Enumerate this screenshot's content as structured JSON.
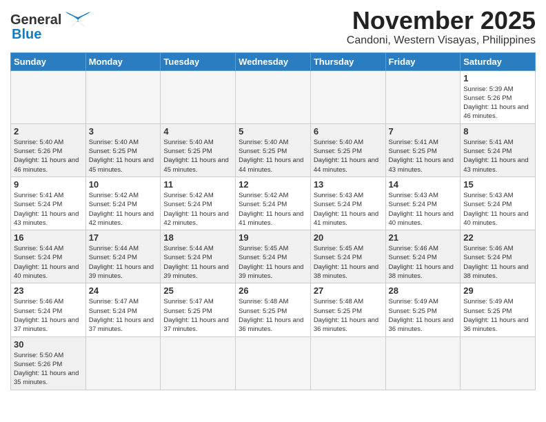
{
  "header": {
    "logo_text_general": "General",
    "logo_text_blue": "Blue",
    "month_title": "November 2025",
    "subtitle": "Candoni, Western Visayas, Philippines"
  },
  "days_of_week": [
    "Sunday",
    "Monday",
    "Tuesday",
    "Wednesday",
    "Thursday",
    "Friday",
    "Saturday"
  ],
  "weeks": [
    {
      "days": [
        {
          "date": "",
          "info": ""
        },
        {
          "date": "",
          "info": ""
        },
        {
          "date": "",
          "info": ""
        },
        {
          "date": "",
          "info": ""
        },
        {
          "date": "",
          "info": ""
        },
        {
          "date": "",
          "info": ""
        },
        {
          "date": "1",
          "info": "Sunrise: 5:39 AM\nSunset: 5:26 PM\nDaylight: 11 hours and 46 minutes."
        }
      ]
    },
    {
      "days": [
        {
          "date": "2",
          "info": "Sunrise: 5:40 AM\nSunset: 5:26 PM\nDaylight: 11 hours and 46 minutes."
        },
        {
          "date": "3",
          "info": "Sunrise: 5:40 AM\nSunset: 5:25 PM\nDaylight: 11 hours and 45 minutes."
        },
        {
          "date": "4",
          "info": "Sunrise: 5:40 AM\nSunset: 5:25 PM\nDaylight: 11 hours and 45 minutes."
        },
        {
          "date": "5",
          "info": "Sunrise: 5:40 AM\nSunset: 5:25 PM\nDaylight: 11 hours and 44 minutes."
        },
        {
          "date": "6",
          "info": "Sunrise: 5:40 AM\nSunset: 5:25 PM\nDaylight: 11 hours and 44 minutes."
        },
        {
          "date": "7",
          "info": "Sunrise: 5:41 AM\nSunset: 5:25 PM\nDaylight: 11 hours and 43 minutes."
        },
        {
          "date": "8",
          "info": "Sunrise: 5:41 AM\nSunset: 5:24 PM\nDaylight: 11 hours and 43 minutes."
        }
      ]
    },
    {
      "days": [
        {
          "date": "9",
          "info": "Sunrise: 5:41 AM\nSunset: 5:24 PM\nDaylight: 11 hours and 43 minutes."
        },
        {
          "date": "10",
          "info": "Sunrise: 5:42 AM\nSunset: 5:24 PM\nDaylight: 11 hours and 42 minutes."
        },
        {
          "date": "11",
          "info": "Sunrise: 5:42 AM\nSunset: 5:24 PM\nDaylight: 11 hours and 42 minutes."
        },
        {
          "date": "12",
          "info": "Sunrise: 5:42 AM\nSunset: 5:24 PM\nDaylight: 11 hours and 41 minutes."
        },
        {
          "date": "13",
          "info": "Sunrise: 5:43 AM\nSunset: 5:24 PM\nDaylight: 11 hours and 41 minutes."
        },
        {
          "date": "14",
          "info": "Sunrise: 5:43 AM\nSunset: 5:24 PM\nDaylight: 11 hours and 40 minutes."
        },
        {
          "date": "15",
          "info": "Sunrise: 5:43 AM\nSunset: 5:24 PM\nDaylight: 11 hours and 40 minutes."
        }
      ]
    },
    {
      "days": [
        {
          "date": "16",
          "info": "Sunrise: 5:44 AM\nSunset: 5:24 PM\nDaylight: 11 hours and 40 minutes."
        },
        {
          "date": "17",
          "info": "Sunrise: 5:44 AM\nSunset: 5:24 PM\nDaylight: 11 hours and 39 minutes."
        },
        {
          "date": "18",
          "info": "Sunrise: 5:44 AM\nSunset: 5:24 PM\nDaylight: 11 hours and 39 minutes."
        },
        {
          "date": "19",
          "info": "Sunrise: 5:45 AM\nSunset: 5:24 PM\nDaylight: 11 hours and 39 minutes."
        },
        {
          "date": "20",
          "info": "Sunrise: 5:45 AM\nSunset: 5:24 PM\nDaylight: 11 hours and 38 minutes."
        },
        {
          "date": "21",
          "info": "Sunrise: 5:46 AM\nSunset: 5:24 PM\nDaylight: 11 hours and 38 minutes."
        },
        {
          "date": "22",
          "info": "Sunrise: 5:46 AM\nSunset: 5:24 PM\nDaylight: 11 hours and 38 minutes."
        }
      ]
    },
    {
      "days": [
        {
          "date": "23",
          "info": "Sunrise: 5:46 AM\nSunset: 5:24 PM\nDaylight: 11 hours and 37 minutes."
        },
        {
          "date": "24",
          "info": "Sunrise: 5:47 AM\nSunset: 5:24 PM\nDaylight: 11 hours and 37 minutes."
        },
        {
          "date": "25",
          "info": "Sunrise: 5:47 AM\nSunset: 5:25 PM\nDaylight: 11 hours and 37 minutes."
        },
        {
          "date": "26",
          "info": "Sunrise: 5:48 AM\nSunset: 5:25 PM\nDaylight: 11 hours and 36 minutes."
        },
        {
          "date": "27",
          "info": "Sunrise: 5:48 AM\nSunset: 5:25 PM\nDaylight: 11 hours and 36 minutes."
        },
        {
          "date": "28",
          "info": "Sunrise: 5:49 AM\nSunset: 5:25 PM\nDaylight: 11 hours and 36 minutes."
        },
        {
          "date": "29",
          "info": "Sunrise: 5:49 AM\nSunset: 5:25 PM\nDaylight: 11 hours and 36 minutes."
        }
      ]
    },
    {
      "days": [
        {
          "date": "30",
          "info": "Sunrise: 5:50 AM\nSunset: 5:26 PM\nDaylight: 11 hours and 35 minutes."
        },
        {
          "date": "",
          "info": ""
        },
        {
          "date": "",
          "info": ""
        },
        {
          "date": "",
          "info": ""
        },
        {
          "date": "",
          "info": ""
        },
        {
          "date": "",
          "info": ""
        },
        {
          "date": "",
          "info": ""
        }
      ]
    }
  ]
}
